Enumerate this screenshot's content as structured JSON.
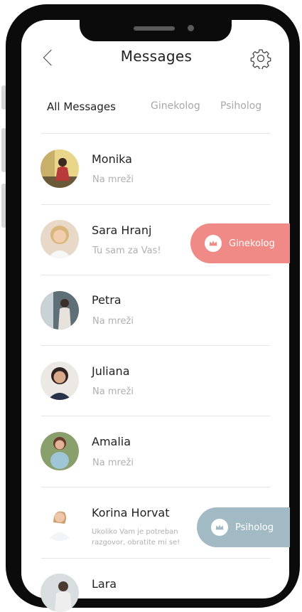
{
  "header": {
    "title": "Messages"
  },
  "tabs": [
    "All Messages",
    "Ginekolog",
    "Psiholog"
  ],
  "contacts": [
    {
      "name": "Monika",
      "status": "Na mreži"
    },
    {
      "name": "Sara Hranj",
      "status": "Tu sam za Vas!",
      "badge": "Ginekolog"
    },
    {
      "name": "Petra",
      "status": "Na mreži"
    },
    {
      "name": "Juliana",
      "status": "Na mreži"
    },
    {
      "name": "Amalia",
      "status": "Na mreži"
    },
    {
      "name": "Korina Horvat",
      "status_line1": "Ukoliko Vam je potreban",
      "status_line2": "razgovor, obratite mi se!",
      "badge": "Psiholog"
    },
    {
      "name": "Lara"
    }
  ],
  "colors": {
    "ginekolog_badge": "#f08a87",
    "psiholog_badge": "#a2bac4"
  },
  "icons": {
    "back": "chevron-left-icon",
    "settings": "gear-icon",
    "badge": "crown-icon"
  }
}
